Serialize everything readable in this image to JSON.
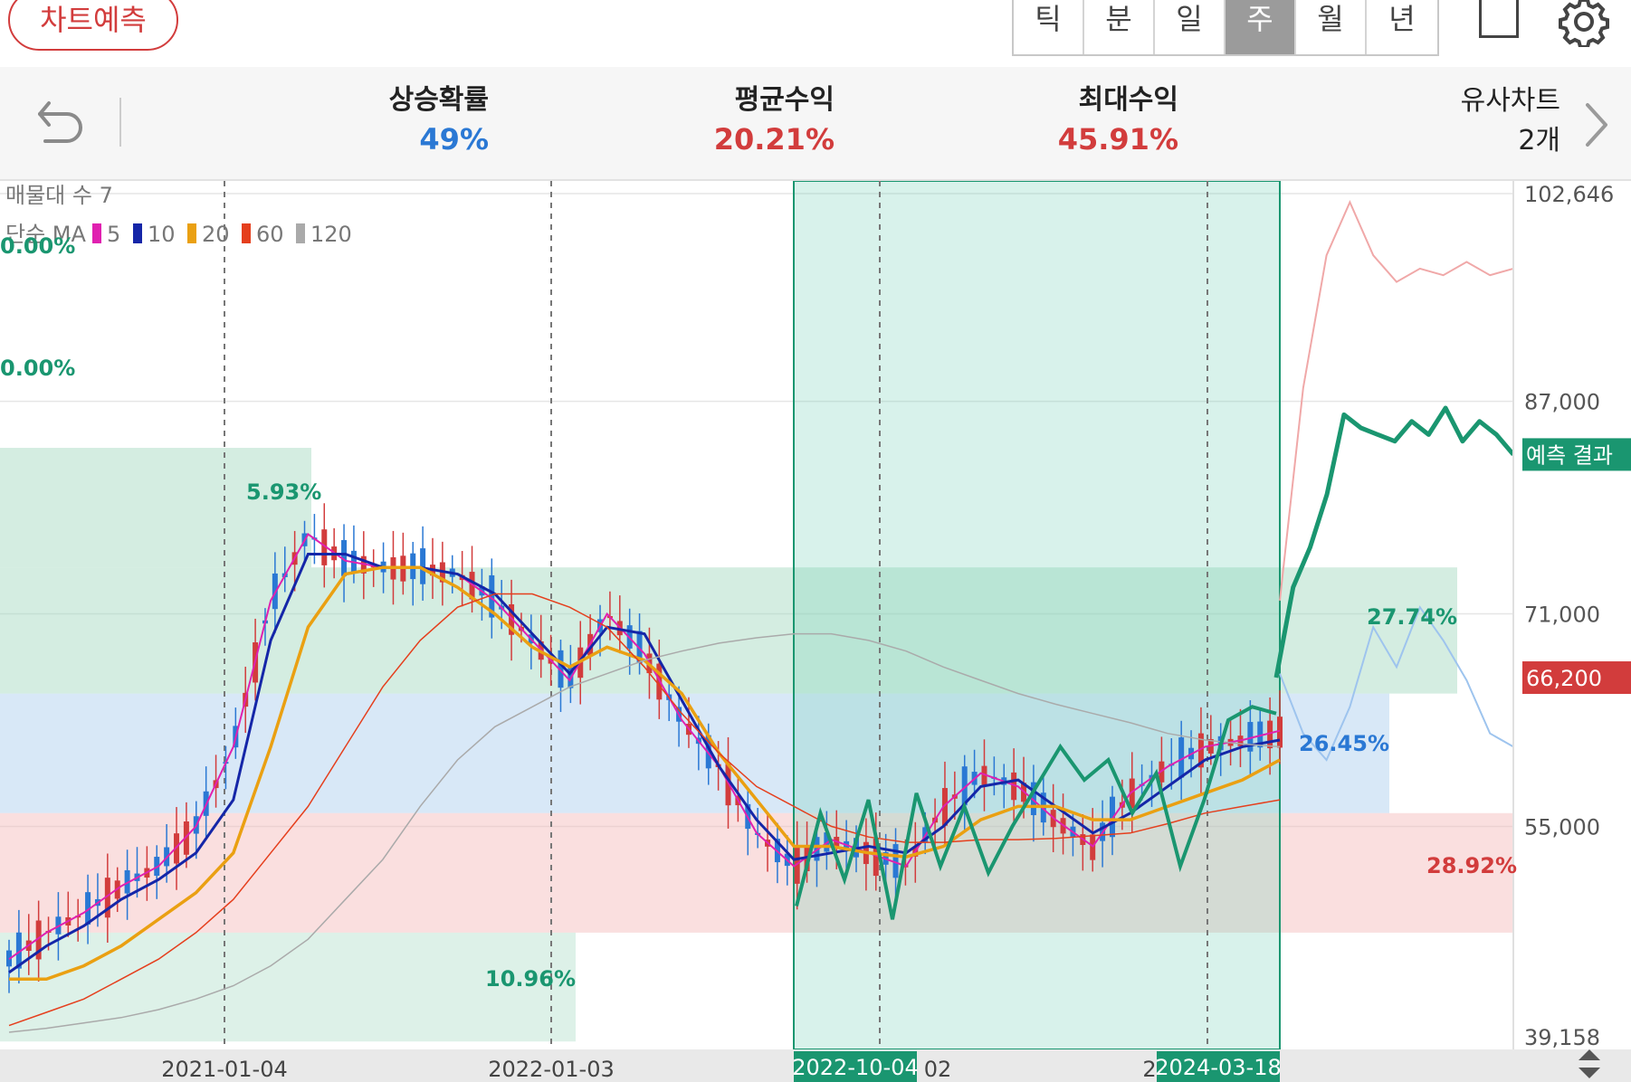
{
  "header": {
    "predict_button": "차트예측",
    "period_tabs": [
      "틱",
      "분",
      "일",
      "주",
      "월",
      "년"
    ],
    "active_period": "주"
  },
  "stats": {
    "rise_prob_label": "상승확률",
    "rise_prob_value": "49%",
    "avg_return_label": "평균수익",
    "avg_return_value": "20.21%",
    "max_return_label": "최대수익",
    "max_return_value": "45.91%",
    "similar_label": "유사차트",
    "similar_value": "2개"
  },
  "colors": {
    "blue": "#2a78d4",
    "red": "#d23c3c",
    "green": "#1a9670",
    "ma5": "#e020b0",
    "ma10": "#1526a8",
    "ma20": "#eaa012",
    "ma60": "#e53f1d",
    "ma120": "#aaaaaa"
  },
  "overlay": {
    "volume_profile_label": "매물대 수 7",
    "ma_label": "단순 MA",
    "ma_periods": [
      "5",
      "10",
      "20",
      "60",
      "120"
    ],
    "pct_labels": [
      "0.00%",
      "0.00%",
      "5.93%",
      "27.74%",
      "26.45%",
      "28.92%",
      "10.96%"
    ],
    "prediction_tag": "예측 결과",
    "current_price_tag": "66,200",
    "date_tag_start": "2022-10-04",
    "date_tag_end": "2024-03-18",
    "partial_tick_a": "02",
    "partial_tick_b": "2"
  },
  "chart_data": {
    "type": "candlestick",
    "ylim": [
      39158,
      102646
    ],
    "ytick_labels": [
      "102,646",
      "87,000",
      "71,000",
      "55,000",
      "39,158"
    ],
    "xtick_labels": [
      "2021-01-04",
      "2022-01-03"
    ],
    "current_price": 66200,
    "ma_series": [
      {
        "name": "5",
        "values": [
          45000,
          47000,
          48500,
          50500,
          52000,
          55000,
          61000,
          72000,
          77000,
          75000,
          74500,
          74500,
          74000,
          72000,
          69000,
          66000,
          71000,
          68000,
          63000,
          59500,
          54500,
          52000,
          54000,
          53000,
          52000,
          56500,
          59000,
          58000,
          55500,
          53500,
          57500,
          59500,
          61000,
          61500,
          62200
        ]
      },
      {
        "name": "10",
        "values": [
          44000,
          46000,
          47500,
          49500,
          51000,
          53000,
          57000,
          69000,
          75500,
          75500,
          74500,
          74500,
          74000,
          72500,
          69500,
          66500,
          70000,
          69500,
          64500,
          59500,
          55500,
          52500,
          53000,
          53500,
          53000,
          55000,
          58000,
          58500,
          56500,
          54500,
          56000,
          58000,
          60000,
          61000,
          61500
        ]
      },
      {
        "name": "20",
        "values": [
          43500,
          43500,
          44500,
          46000,
          48000,
          50000,
          53000,
          61000,
          70000,
          74000,
          74500,
          74500,
          73000,
          71000,
          68500,
          67000,
          68500,
          67500,
          65000,
          60500,
          57000,
          53500,
          53500,
          53000,
          52700,
          53500,
          55500,
          56500,
          56500,
          55500,
          55500,
          56500,
          57500,
          58500,
          60000
        ]
      },
      {
        "name": "60",
        "values": [
          40000,
          41000,
          42000,
          43500,
          45000,
          47000,
          49500,
          53000,
          56500,
          61000,
          65500,
          69000,
          71500,
          72500,
          72500,
          71500,
          70000,
          67000,
          63500,
          60500,
          58000,
          56500,
          55000,
          54200,
          53800,
          53800,
          54000,
          54000,
          54100,
          54300,
          54500,
          55200,
          56000,
          56500,
          57000
        ]
      },
      {
        "name": "120",
        "values": [
          39500,
          39800,
          40200,
          40600,
          41200,
          42000,
          43000,
          44500,
          46500,
          49500,
          52500,
          56500,
          60000,
          62500,
          64000,
          65500,
          66500,
          67500,
          68200,
          68800,
          69200,
          69500,
          69500,
          69000,
          68200,
          67000,
          66000,
          65000,
          64200,
          63500,
          62800,
          62000,
          61500,
          61200,
          61000
        ]
      }
    ],
    "projection": {
      "name": "예측 결과",
      "values": [
        66200,
        73000,
        76000,
        80000,
        86000,
        85000,
        84500,
        84000,
        85500,
        84500,
        86500,
        84000,
        85500,
        84500,
        83000
      ]
    },
    "similar_upper": {
      "values": [
        72000,
        88000,
        98000,
        102000,
        98000,
        96000,
        97000,
        96500,
        97500,
        96500,
        97000
      ]
    },
    "similar_lower": {
      "values": [
        66500,
        62000,
        60000,
        64000,
        70000,
        67000,
        71500,
        69000,
        66000,
        62000,
        61000
      ]
    },
    "zone_labels": [
      "0.00%",
      "0.00%",
      "5.93%",
      "27.74%",
      "26.45%",
      "28.92%",
      "10.96%"
    ]
  }
}
